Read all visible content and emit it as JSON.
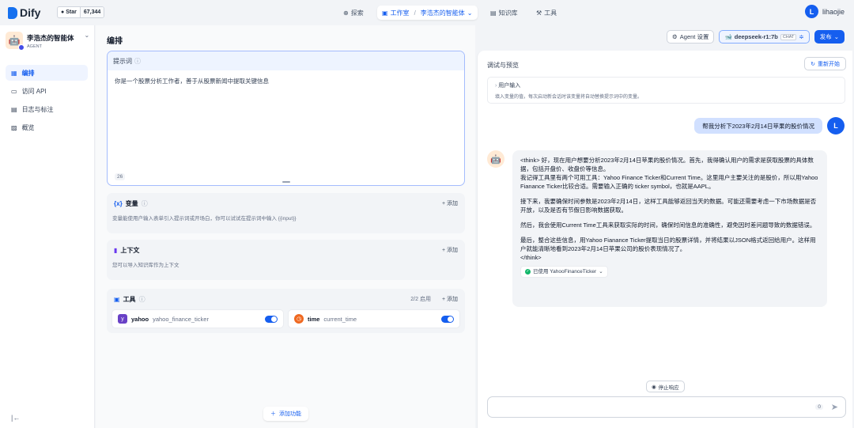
{
  "topbar": {
    "brand": "Dify",
    "github_star": "Star",
    "github_count": "67,344",
    "explore": "探索",
    "studio": "工作室",
    "app_crumb": "李浩杰的智能体",
    "knowledge": "知识库",
    "tools": "工具",
    "user_initial": "L",
    "user_name": "lihaojie"
  },
  "sidebar": {
    "app_name": "李浩杰的智能体",
    "app_type": "AGENT",
    "items": [
      {
        "label": "编排"
      },
      {
        "label": "访问 API"
      },
      {
        "label": "日志与标注"
      },
      {
        "label": "概览"
      }
    ]
  },
  "orchestrate": {
    "title": "编排",
    "prompt_label": "提示词",
    "prompt_text": "你是一个股票分析工作者，善于从股票新闻中提取关键信息",
    "prompt_count": "26",
    "variables": {
      "title": "变量",
      "add": "+ 添加",
      "desc": "变量能使用户输入表单引入提示词或开场白，你可以试试在提示词中输入 {{input}}"
    },
    "context": {
      "title": "上下文",
      "add": "+ 添加",
      "desc": "您可以导入知识库作为上下文"
    },
    "tools": {
      "title": "工具",
      "enabled": "2/2 启用",
      "add": "+ 添加",
      "items": [
        {
          "name": "yahoo",
          "id": "yahoo_finance_ticker"
        },
        {
          "name": "time",
          "id": "current_time"
        }
      ]
    },
    "add_feature": "添加功能"
  },
  "header_actions": {
    "agent_settings": "Agent 设置",
    "model": "deepseek-r1:7b",
    "model_mode": "CHAT",
    "publish": "发布"
  },
  "debug": {
    "title": "调试与预览",
    "restart": "重新开始",
    "user_input_label": "用户输入",
    "user_input_desc": "填入变量的值，每次启动新会话时该变量将自动替换提示词中的变量。",
    "question": "帮我分析下2023年2月14日苹果的股价情况",
    "answer": [
      "<think> 好，现在用户想要分析2023年2月14日苹果的股价情况。首先，我得确认用户的需求是获取股票的具体数据，包括开盘价、收盘价等信息。\n我记得工具里有两个可用工具：Yahoo Finance Ticker和Current Time。这里用户主要关注的是股价，所以用Yahoo Fianance Ticker比较合适。需要输入正确的 ticker symbol，也就是AAPL。",
      "接下来，我要确保时间参数是2023年2月14日，这样工具能够返回当天的数据。可能还需要考虑一下市场数据是否开放，以及是否有节假日影响数据获取。",
      "然后，我会使用Current Time工具来获取实际的时间，确保时间信息的准确性，避免因时差问题导致的数据错误。",
      "最后，整合这些信息，用Yahoo Fianance Ticker提取当日的股票详情，并将结果以JSON格式返回给用户。这样用户就能清晰地看到2023年2月14日苹果公司的股价表现情况了。\n</think>"
    ],
    "used_tool": "已使用 YahooFinanceTicker",
    "stop": "停止响应",
    "input_count": "0"
  }
}
